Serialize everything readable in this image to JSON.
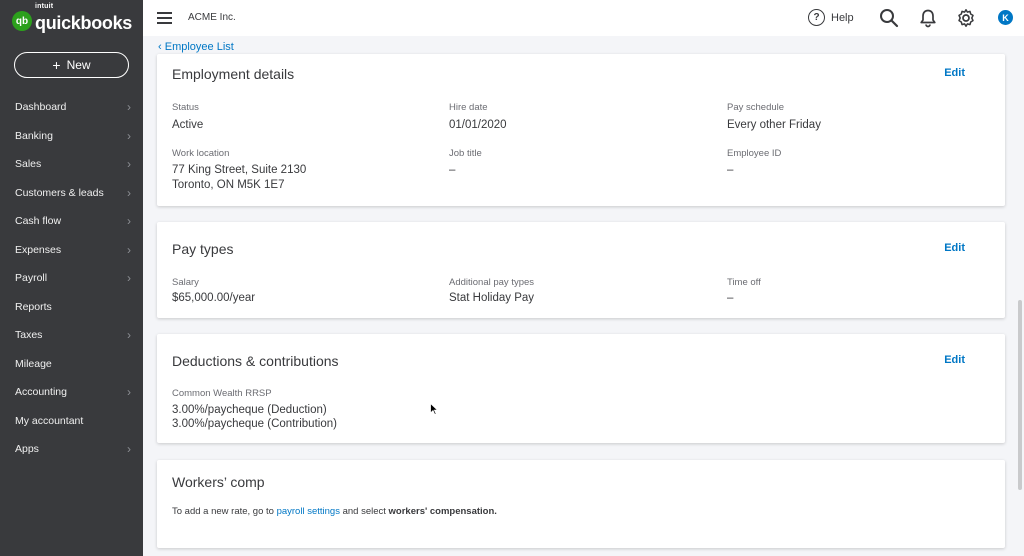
{
  "app": {
    "logo_sub": "intuit",
    "logo_main": "quickbooks",
    "logo_mark": "qb",
    "new_label": "New"
  },
  "sidebar": {
    "items": [
      {
        "label": "Dashboard",
        "chevron": true
      },
      {
        "label": "Banking",
        "chevron": true
      },
      {
        "label": "Sales",
        "chevron": true
      },
      {
        "label": "Customers & leads",
        "chevron": true
      },
      {
        "label": "Cash flow",
        "chevron": true
      },
      {
        "label": "Expenses",
        "chevron": true
      },
      {
        "label": "Payroll",
        "chevron": true
      },
      {
        "label": "Reports",
        "chevron": false
      },
      {
        "label": "Taxes",
        "chevron": true
      },
      {
        "label": "Mileage",
        "chevron": false
      },
      {
        "label": "Accounting",
        "chevron": true
      },
      {
        "label": "My accountant",
        "chevron": false
      },
      {
        "label": "Apps",
        "chevron": true
      }
    ]
  },
  "topbar": {
    "company": "ACME Inc.",
    "help_label": "Help",
    "avatar_initial": "K",
    "icons": [
      "menu-icon",
      "help-icon",
      "search-icon",
      "bell-icon",
      "gear-icon"
    ]
  },
  "breadcrumb": {
    "label": "Employee List"
  },
  "employment": {
    "title": "Employment details",
    "edit": "Edit",
    "status_label": "Status",
    "status_value": "Active",
    "hire_label": "Hire date",
    "hire_value": "01/01/2020",
    "schedule_label": "Pay schedule",
    "schedule_value": "Every other Friday",
    "location_label": "Work location",
    "location_line1": "77 King Street, Suite 2130",
    "location_line2": "Toronto, ON M5K 1E7",
    "job_label": "Job title",
    "job_value": "–",
    "empid_label": "Employee ID",
    "empid_value": "–"
  },
  "pay_types": {
    "title": "Pay types",
    "edit": "Edit",
    "salary_label": "Salary",
    "salary_value": "$65,000.00/year",
    "additional_label": "Additional pay types",
    "additional_value": "Stat Holiday Pay",
    "timeoff_label": "Time off",
    "timeoff_value": "–"
  },
  "deductions": {
    "title": "Deductions & contributions",
    "edit": "Edit",
    "plan_label": "Common Wealth RRSP",
    "line1": "3.00%/paycheque (Deduction)",
    "line2": "3.00%/paycheque (Contribution)"
  },
  "workers_comp": {
    "title": "Workers’ comp",
    "text_before": "To add a new rate, go to ",
    "link": "payroll settings",
    "text_middle": " and select ",
    "bold": "workers' compensation."
  },
  "colors": {
    "sidebar_bg": "#393a3d",
    "brand_green": "#2ca01c",
    "link_blue": "#0077c5"
  }
}
